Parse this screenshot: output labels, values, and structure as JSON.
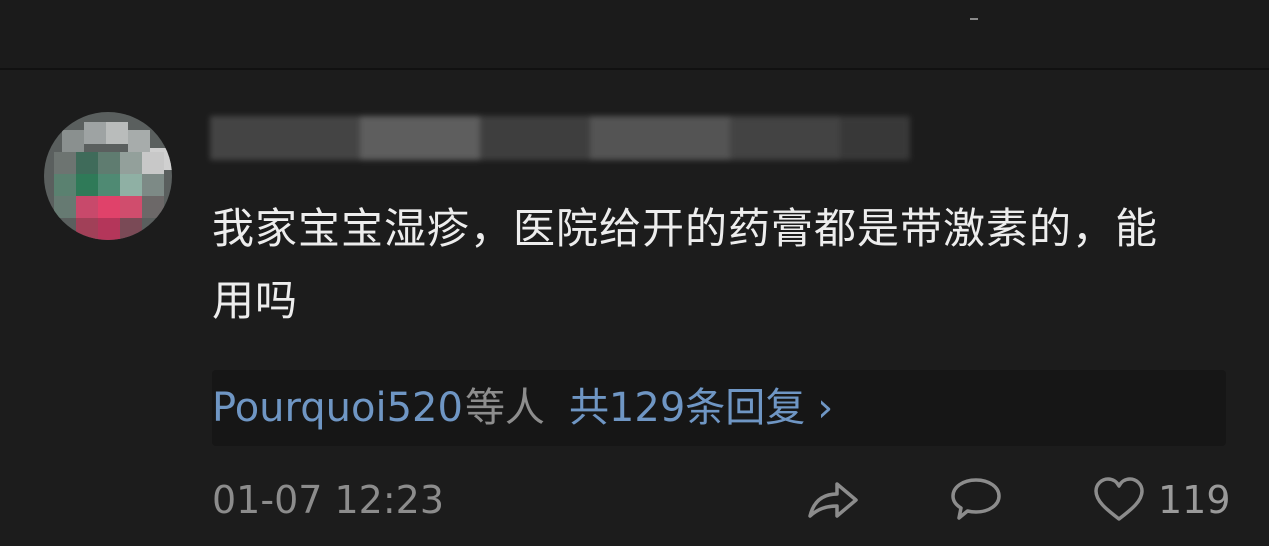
{
  "comment": {
    "text": "我家宝宝湿疹，医院给开的药膏都是带激素的，能用吗",
    "timestamp": "01-07 12:23",
    "like_count": "119"
  },
  "replies": {
    "first_user": "Pourquoi520",
    "others_suffix": "等人",
    "count_label": "共129条回复",
    "chevron": "›"
  },
  "colors": {
    "background": "#1c1c1c",
    "link": "#6f96c4",
    "text": "#ededed",
    "muted": "#8c8c8c"
  },
  "icons": {
    "share": "share-icon",
    "comment": "comment-icon",
    "like": "heart-icon",
    "reply_more": "chevron-right-icon"
  }
}
